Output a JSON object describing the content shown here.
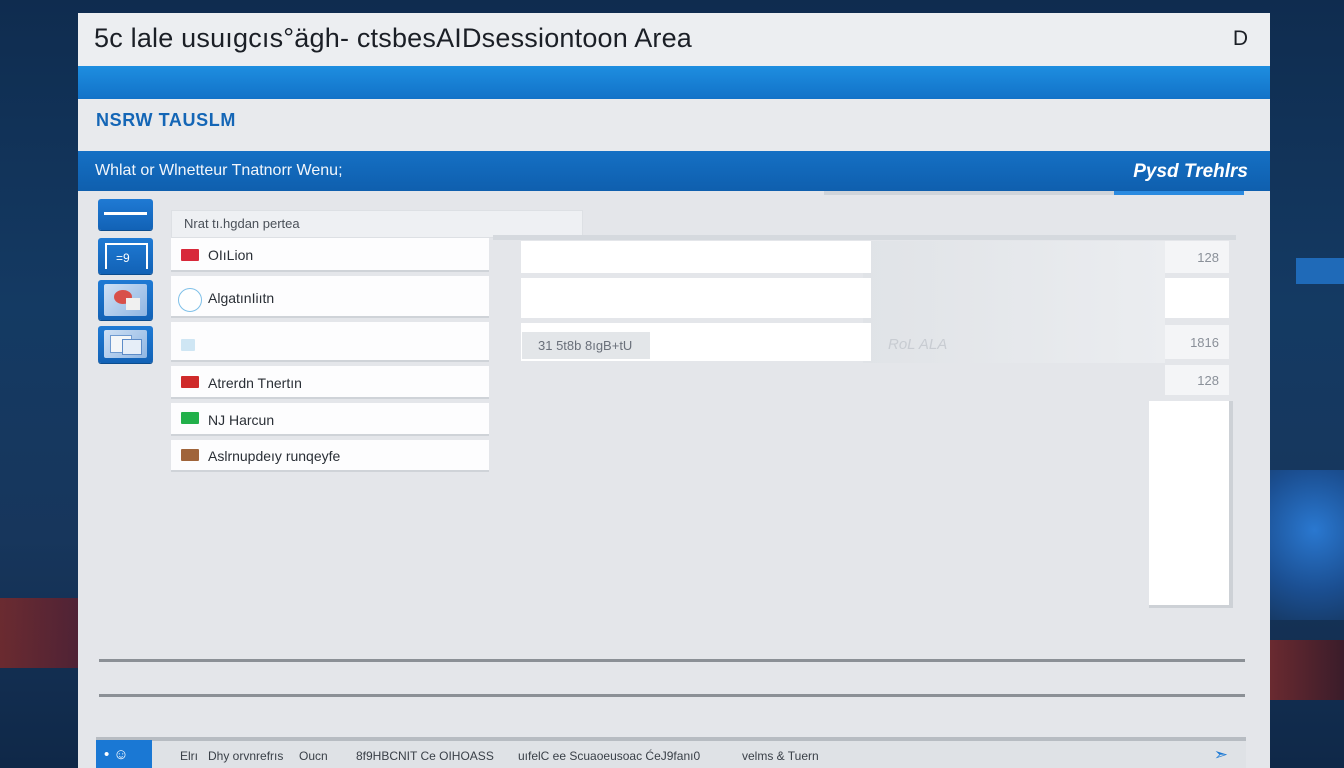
{
  "window": {
    "title": "5c lale usuıgcıs°ägh- ctsbesAIDsessiontoon Area",
    "title_button": "D"
  },
  "subheader": {
    "title": "NSRW TAUSLM"
  },
  "menubar": {
    "label": "Whlat  or Wlnetteur  Tnatnorr Wenu;",
    "right_label": "Pysd Trehlrs"
  },
  "sidebar": {
    "buttons": [
      {
        "icon": "minus-icon"
      },
      {
        "icon": "window-icon",
        "glyph": "=9"
      },
      {
        "icon": "image-icon"
      },
      {
        "icon": "gallery-icon"
      }
    ]
  },
  "search": {
    "placeholder": "Nrat  tı.hgdan pertea"
  },
  "list": {
    "items": [
      {
        "label": "OIıLion",
        "color": "#d8283a"
      },
      {
        "label": "AlgatınIiıtn",
        "color": "#5aa9dc"
      },
      {
        "label": "",
        "color": "#cfe6f4"
      },
      {
        "label": "Atrerdn Tnertın",
        "color": "#cf2a2a"
      },
      {
        "label": "NJ Harcun",
        "color": "#22b04a"
      },
      {
        "label": "Aslrnupdeıy runqeyfe",
        "color": "#a0643a"
      }
    ]
  },
  "panel": {
    "chip": "31 5t8b 8ıgB+tU",
    "ghost": "RoL ALA",
    "values": [
      "128",
      "",
      "1816",
      "128"
    ]
  },
  "statusbar": {
    "button_glyph": "• ☺",
    "items": [
      "Elrı",
      "Dhy orvnrefrıs",
      "Oucn",
      "8f9HBCNIT Ce OIHOASS",
      "uıfelC ee Scuaoeusoac ĆeJ9fanı0",
      "velms & Tuern"
    ],
    "icon": "cursor-icon"
  },
  "colors": {
    "accent": "#1570c4",
    "window_bg": "#e4e6ea"
  }
}
